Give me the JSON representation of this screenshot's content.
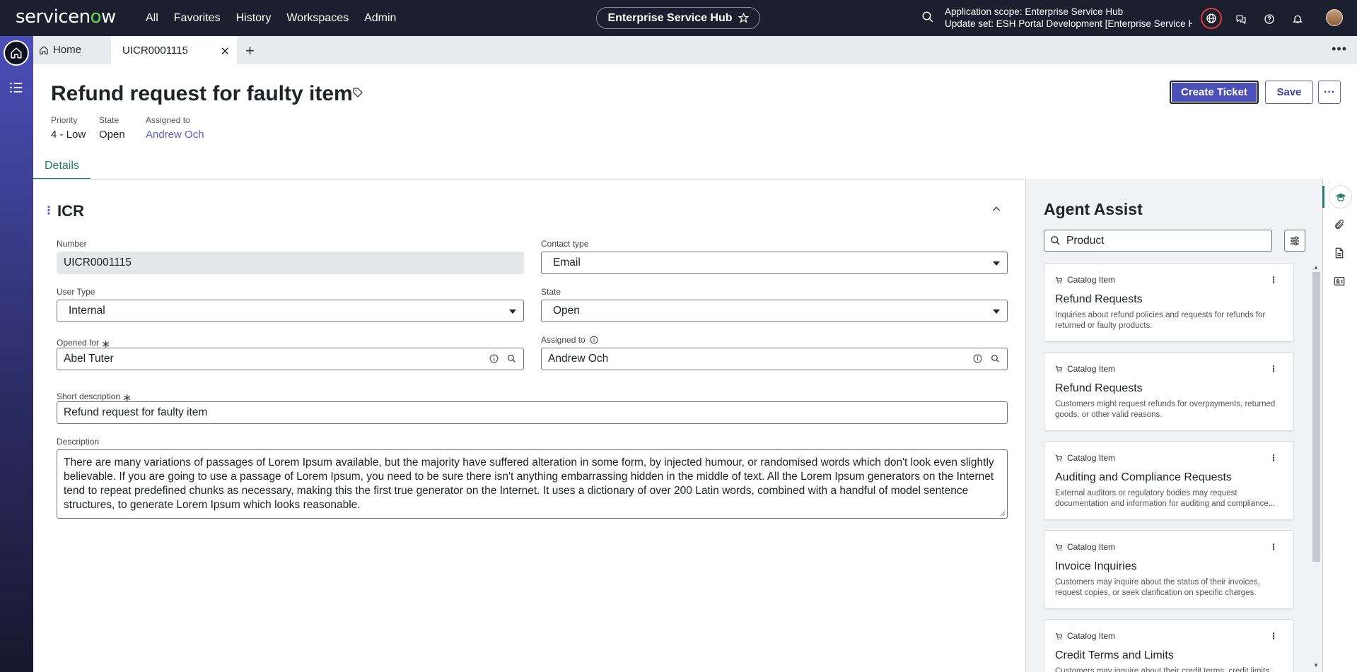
{
  "topnav": {
    "logo_service": "servicen",
    "logo_o": "o",
    "logo_w": "w",
    "menu": [
      "All",
      "Favorites",
      "History",
      "Workspaces",
      "Admin"
    ],
    "hub": "Enterprise Service Hub",
    "scope_line1": "Application scope: Enterprise Service Hub",
    "scope_line2": "Update set: ESH Portal Development [Enterprise Service H..."
  },
  "tabs": {
    "home": "Home",
    "active": "UICR0001115",
    "more": "•••"
  },
  "record": {
    "title": "Refund request for faulty item",
    "priority_label": "Priority",
    "priority": "4 - Low",
    "state_label": "State",
    "state": "Open",
    "assigned_label": "Assigned to",
    "assigned": "Andrew Och"
  },
  "actions": {
    "create": "Create Ticket",
    "save": "Save",
    "more": "···"
  },
  "details_tab": "Details",
  "form": {
    "section": "ICR",
    "number_label": "Number",
    "number": "UICR0001115",
    "contact_label": "Contact type",
    "contact": "Email",
    "usertype_label": "User Type",
    "usertype": "Internal",
    "state_label": "State",
    "state": "Open",
    "openedfor_label": "Opened for",
    "openedfor": "Abel Tuter",
    "assigned_label": "Assigned to",
    "assigned": "Andrew Och",
    "short_label": "Short description",
    "short": "Refund request for faulty item",
    "desc_label": "Description",
    "description": "There are many variations of passages of Lorem Ipsum available, but the majority have suffered alteration in some form, by injected humour, or randomised words which don't look even slightly believable. If you are going to use a passage of Lorem Ipsum, you need to be sure there isn't anything embarrassing hidden in the middle of text. All the Lorem Ipsum generators on the Internet tend to repeat predefined chunks as necessary, making this the first true generator on the Internet. It uses a dictionary of over 200 Latin words, combined with a handful of model sentence structures, to generate Lorem Ipsum which looks reasonable."
  },
  "agent_assist": {
    "title": "Agent Assist",
    "search_value": "Product",
    "cards": [
      {
        "type": "Catalog Item",
        "title": "Refund Requests",
        "desc": "Inquiries about refund policies and requests for refunds for returned or faulty products."
      },
      {
        "type": "Catalog Item",
        "title": "Refund Requests",
        "desc": "Customers might request refunds for overpayments, returned goods, or other valid reasons."
      },
      {
        "type": "Catalog Item",
        "title": "Auditing and Compliance Requests",
        "desc": "External auditors or regulatory bodies may request documentation and information for auditing and compliance..."
      },
      {
        "type": "Catalog Item",
        "title": "Invoice Inquiries",
        "desc": "Customers may inquire about the status of their invoices, request copies, or seek clarification on specific charges."
      },
      {
        "type": "Catalog Item",
        "title": "Credit Terms and Limits",
        "desc": "Customers may inquire about their credit terms, credit limits..."
      }
    ]
  },
  "colors": {
    "nav_bg": "#1c1f2e",
    "accent": "#4b4fb8",
    "link": "#5b5fc7",
    "green": "#227d6b",
    "alert_ring": "#e23b3b"
  }
}
